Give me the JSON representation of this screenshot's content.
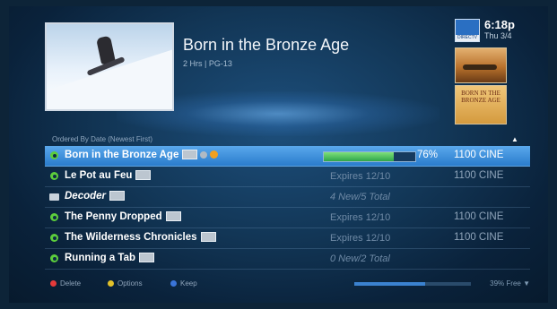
{
  "header": {
    "title": "Born in the Bronze Age",
    "meta": "2 Hrs  |  PG-13",
    "time": "6:18p",
    "date": "Thu 3/4",
    "logo_text": "DIRECTV",
    "thumb2_text": "BORN IN THE BRONZE AGE"
  },
  "list": {
    "sort_label": "Ordered By Date (Newest First)",
    "rows": [
      {
        "name": "Born in the Bronze Age",
        "progress": 0.76,
        "progress_label": "76%",
        "channel": "1100 CINE",
        "selected": true
      },
      {
        "name": "Le Pot au Feu",
        "status": "Expires 12/10",
        "channel": "1100 CINE"
      },
      {
        "name": "Decoder",
        "status": "4 New/5 Total",
        "channel": ""
      },
      {
        "name": "The Penny Dropped",
        "status": "Expires 12/10",
        "channel": "1100 CINE"
      },
      {
        "name": "The Wilderness Chronicles",
        "status": "Expires 12/10",
        "channel": "1100 CINE"
      },
      {
        "name": "Running a Tab",
        "status": "0 New/2 Total",
        "channel": ""
      }
    ]
  },
  "footer": {
    "delete_label": "Delete",
    "options_label": "Options",
    "keep_label": "Keep",
    "free_label": "39% Free",
    "free_fraction": 0.39
  },
  "colors": {
    "selected_row": "#3a8ede",
    "progress_fill": "#3bb04c",
    "delete": "#e43a3a",
    "options": "#e2c12a",
    "keep": "#3a74d8"
  }
}
